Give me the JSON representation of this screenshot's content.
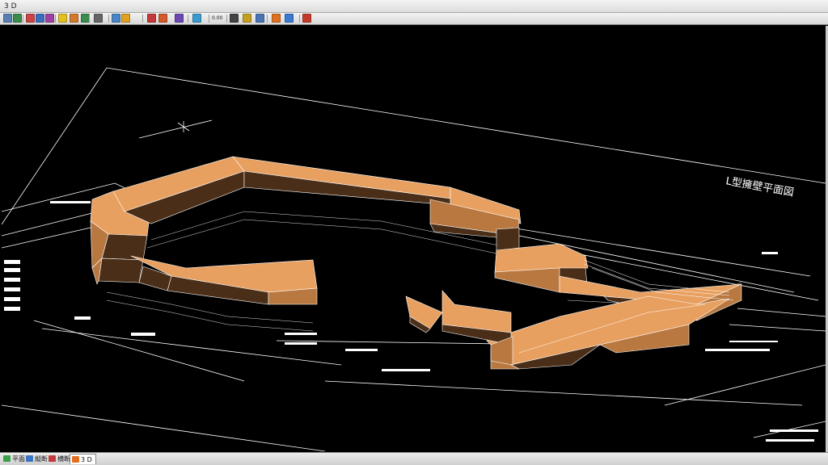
{
  "window": {
    "title": "3 D"
  },
  "toolbar": {
    "buttons": [
      {
        "icon": "print-preview-icon",
        "color": "#5a7fb0"
      },
      {
        "icon": "pen-icon",
        "color": "#3a8c4c"
      },
      {
        "icon": "shape-icon",
        "color": "#c44"
      },
      {
        "icon": "sphere-icon",
        "color": "#3b6cc0"
      },
      {
        "icon": "color-icon",
        "color": "#a040a0"
      },
      {
        "icon": "light-icon",
        "color": "#e2c020"
      },
      {
        "icon": "layers-icon",
        "color": "#d27a2b"
      },
      {
        "icon": "grid-icon",
        "color": "#3a8c4c"
      },
      {
        "icon": "axis-icon",
        "color": "#666"
      },
      {
        "icon": "view-front-icon",
        "color": "#4a84c4"
      },
      {
        "icon": "view-iso-icon",
        "color": "#e0a020"
      },
      {
        "icon": "render-icon",
        "color": "#c43a3a"
      },
      {
        "icon": "surface-icon",
        "color": "#d45a2a"
      },
      {
        "icon": "cube-icon",
        "color": "#6a4ab0"
      },
      {
        "icon": "rotate-icon",
        "color": "#3a9ad0"
      },
      {
        "icon": "text-icon",
        "color": "#444"
      },
      {
        "icon": "picture-icon",
        "color": "#c4a020"
      },
      {
        "icon": "document-icon",
        "color": "#4a74b4"
      },
      {
        "icon": "paint-icon",
        "color": "#e07020"
      },
      {
        "icon": "refresh-icon",
        "color": "#3a7ad0"
      },
      {
        "icon": "export-icon",
        "color": "#c43a2a"
      }
    ],
    "scale_label": "0.00"
  },
  "tabs": [
    {
      "label": "平面",
      "icon": "plan-view-icon",
      "color": "#3aa04a"
    },
    {
      "label": "縦断",
      "icon": "profile-view-icon",
      "color": "#3a74c4"
    },
    {
      "label": "横断",
      "icon": "cross-section-icon",
      "color": "#c43a3a"
    },
    {
      "label": "3 D",
      "icon": "3d-view-icon",
      "color": "#e07020",
      "active": true
    }
  ],
  "drawing": {
    "title_label": "L型擁壁平面図",
    "wall_color": "#e8a060",
    "wall_dark": "#4a2e18",
    "wall_mid": "#b87840"
  }
}
